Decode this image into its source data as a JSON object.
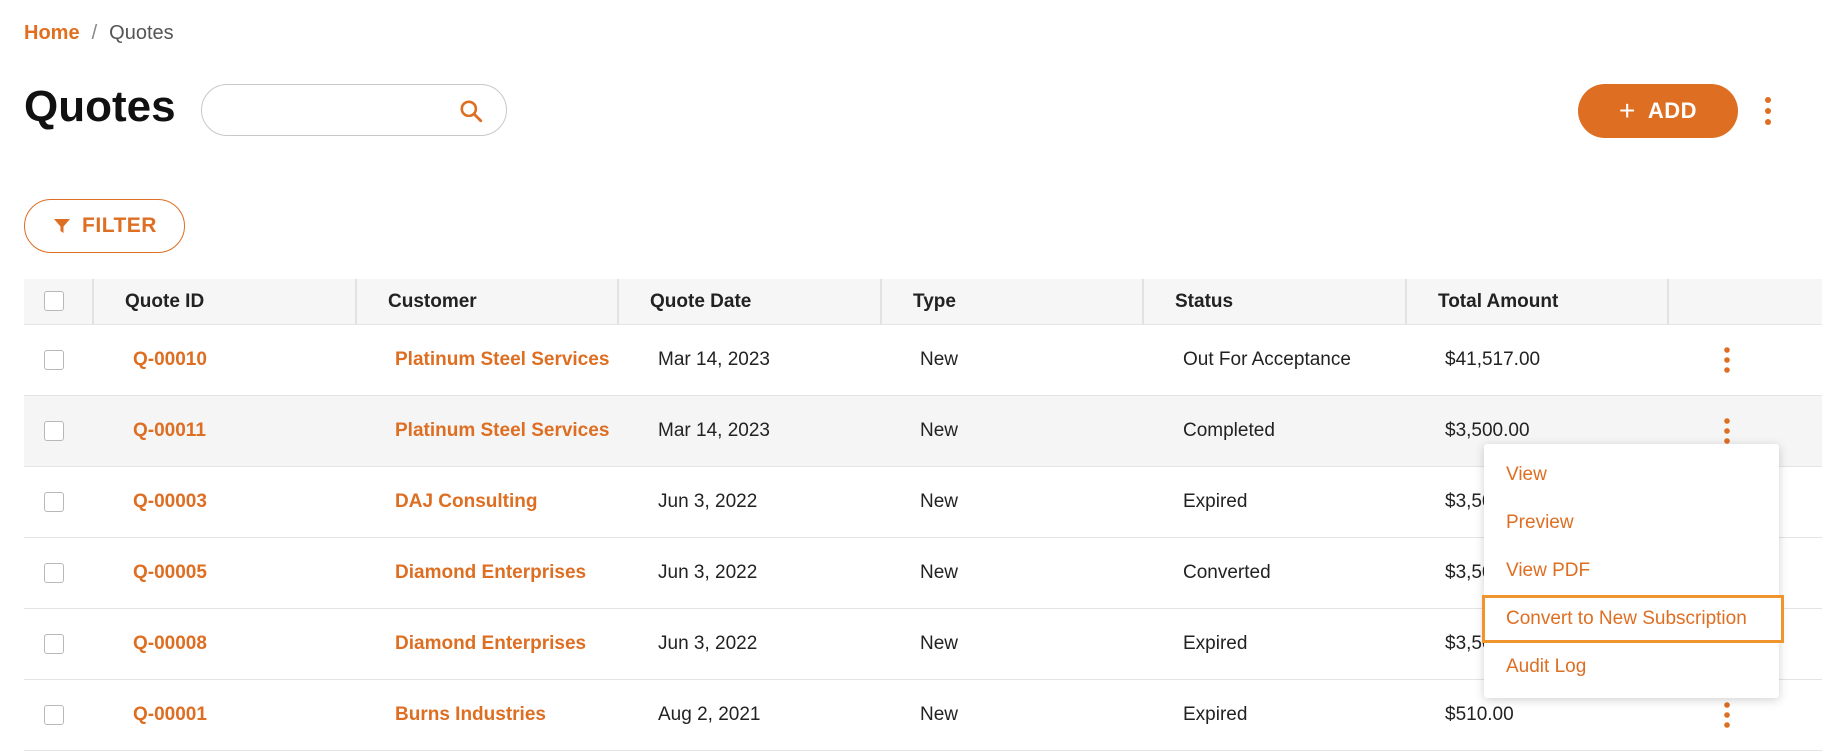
{
  "breadcrumb": {
    "home": "Home",
    "separator": "/",
    "current": "Quotes"
  },
  "page": {
    "title": "Quotes"
  },
  "search": {
    "value": "",
    "placeholder": ""
  },
  "actions": {
    "add_label": "ADD",
    "filter_label": "FILTER"
  },
  "colors": {
    "accent": "#dd6e22",
    "focus_border": "#f0952e"
  },
  "table": {
    "columns": [
      "Quote ID",
      "Customer",
      "Quote Date",
      "Type",
      "Status",
      "Total Amount"
    ],
    "rows": [
      {
        "id": "Q-00010",
        "customer": "Platinum Steel Services",
        "date": "Mar 14, 2023",
        "type": "New",
        "status": "Out For Acceptance",
        "amount": "$41,517.00"
      },
      {
        "id": "Q-00011",
        "customer": "Platinum Steel Services",
        "date": "Mar 14, 2023",
        "type": "New",
        "status": "Completed",
        "amount": "$3,500.00"
      },
      {
        "id": "Q-00003",
        "customer": "DAJ Consulting",
        "date": "Jun 3, 2022",
        "type": "New",
        "status": "Expired",
        "amount": "$3,50"
      },
      {
        "id": "Q-00005",
        "customer": "Diamond Enterprises",
        "date": "Jun 3, 2022",
        "type": "New",
        "status": "Converted",
        "amount": "$3,50"
      },
      {
        "id": "Q-00008",
        "customer": "Diamond Enterprises",
        "date": "Jun 3, 2022",
        "type": "New",
        "status": "Expired",
        "amount": "$3,50"
      },
      {
        "id": "Q-00001",
        "customer": "Burns Industries",
        "date": "Aug 2, 2021",
        "type": "New",
        "status": "Expired",
        "amount": "$510.00"
      }
    ]
  },
  "row_menu": {
    "items": [
      "View",
      "Preview",
      "View PDF",
      "Convert to New Subscription",
      "Audit Log"
    ]
  },
  "icons": {
    "search": "search-icon",
    "add": "plus-icon",
    "more": "kebab-icon",
    "filter": "funnel-icon"
  }
}
